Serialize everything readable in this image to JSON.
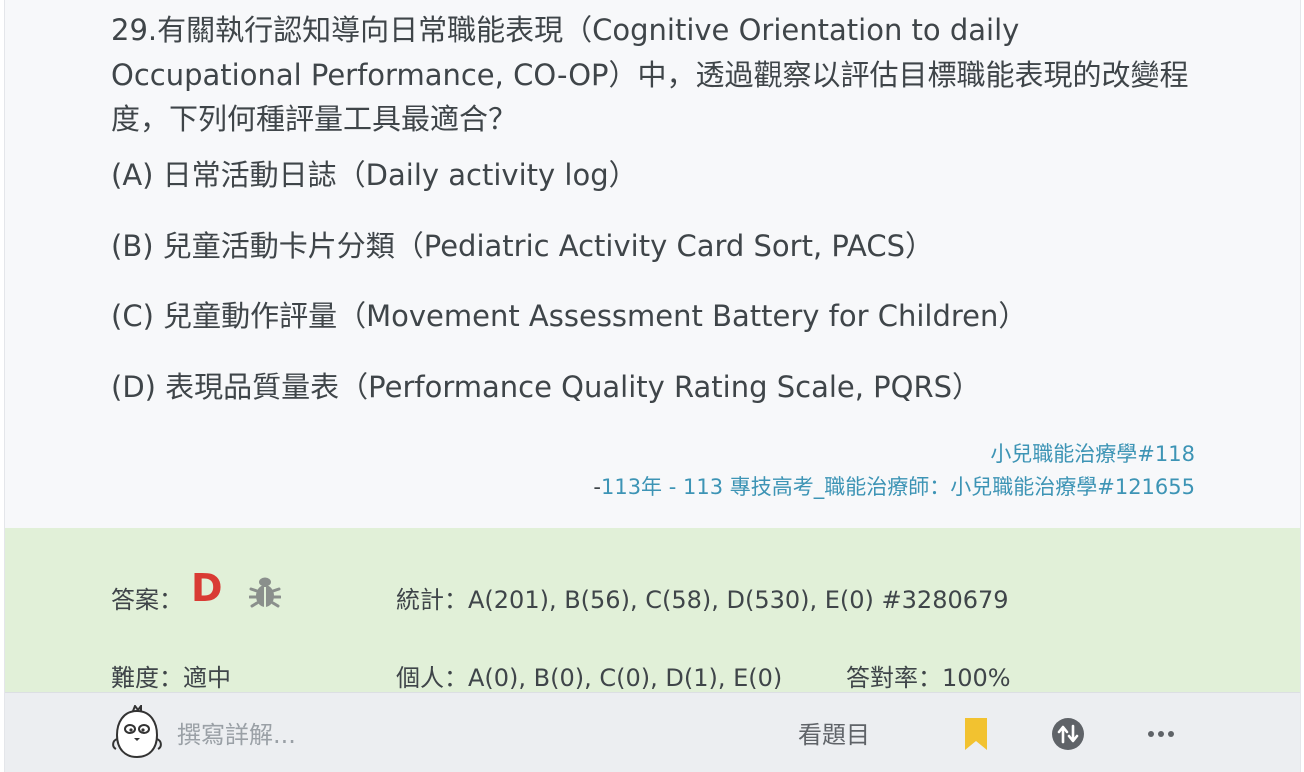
{
  "question": {
    "text": "29.有關執行認知導向日常職能表現（Cognitive Orientation to daily Occupational Performance, CO-OP）中，透過觀察以評估目標職能表現的改變程度，下列何種評量工具最適合？",
    "options": [
      "(A) 日常活動日誌（Daily activity log）",
      "(B) 兒童活動卡片分類（Pediatric Activity Card Sort, PACS）",
      "(C) 兒童動作評量（Movement Assessment Battery for Children）",
      "(D) 表現品質量表（Performance Quality Rating Scale, PQRS）"
    ]
  },
  "source": {
    "category_link": "小兒職能治療學#118",
    "dash": "-",
    "exam_link": "113年 - 113 專技高考_職能治療師：小兒職能治療學#121655"
  },
  "answer_panel": {
    "answer_label": "答案：",
    "answer_value": "D",
    "answer_color": "#d93b34",
    "report_icon": "bug-icon",
    "stats": "統計：A(201), B(56), C(58), D(530), E(0) #3280679",
    "difficulty": "難度：適中",
    "personal": "個人：A(0), B(0), C(0), D(1), E(0)",
    "accuracy": "答對率：100%"
  },
  "bottom_bar": {
    "write_placeholder": "撰寫詳解...",
    "view_question": "看題目",
    "icons": [
      "mascot-avatar",
      "bookmark-icon",
      "swap-icon",
      "more-icon"
    ]
  },
  "colors": {
    "panel_bg": "#e1f0d8",
    "link": "#3d94b5",
    "bookmark": "#f2c230"
  }
}
